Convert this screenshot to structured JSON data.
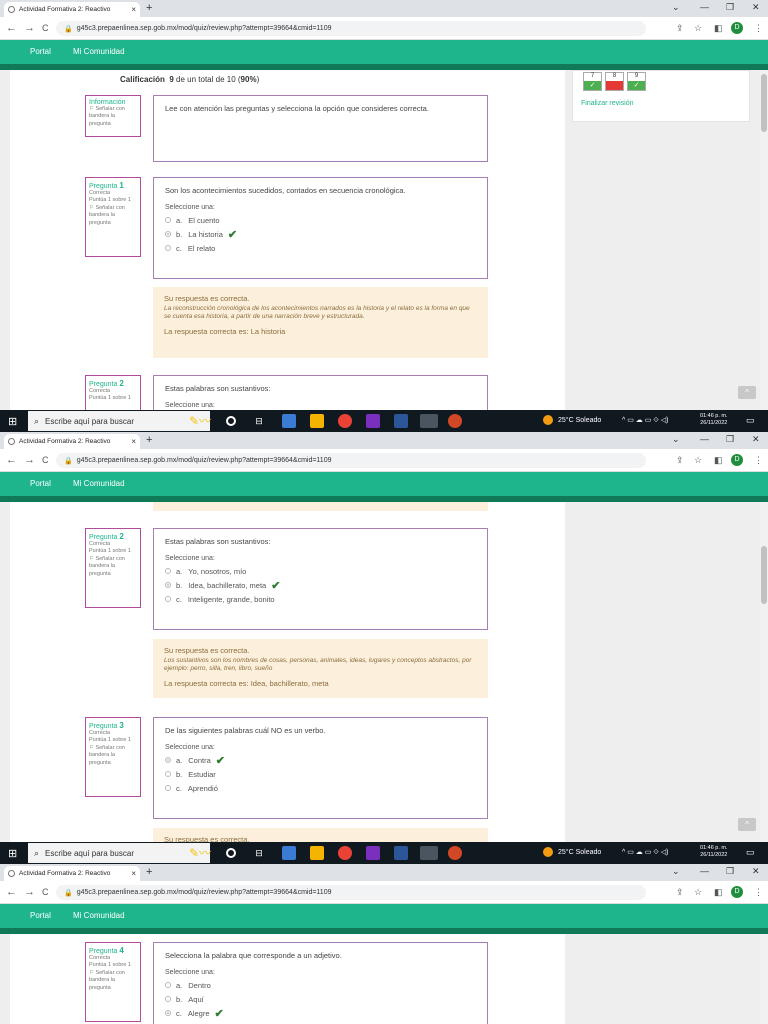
{
  "browser": {
    "tab_title": "Actividad Formativa 2: Reactivo",
    "tab_close": "×",
    "new_tab": "+",
    "url": "g45c3.prepaenlinea.sep.gob.mx/mod/quiz/review.php?attempt=39664&cmid=1109",
    "profile_initial": "D",
    "back": "←",
    "forward": "→",
    "reload": "C",
    "minimize": "—",
    "restore": "❐",
    "close": "✕",
    "dropdown": "⌄",
    "share_icon": "⇪",
    "star_icon": "☆",
    "sidebar_icon": "◧",
    "more_icon": "⋮"
  },
  "site_nav": {
    "portal": "Portal",
    "community": "Mi Comunidad"
  },
  "summary": {
    "label": "Calificación",
    "value_prefix": "9",
    "value_suffix": "de un total de 10 (",
    "percent": "90%",
    "close_paren": ")"
  },
  "info": {
    "title": "Información",
    "flag": "⚐ Señalar con bandera la pregunta",
    "text": "Lee con atención las preguntas y selecciona la opción que consideres correcta."
  },
  "nav_panel": {
    "buttons": [
      {
        "num": "7",
        "mark": "✓",
        "state": "good"
      },
      {
        "num": "8",
        "mark": "",
        "state": "bad"
      },
      {
        "num": "9",
        "mark": "✓",
        "state": "good"
      }
    ],
    "finish": "Finalizar revisión"
  },
  "common": {
    "question_word": "Pregunta",
    "state": "Correcta",
    "grade": "Puntúa 1 sobre 1",
    "flag": "⚐ Señalar con bandera la pregunta",
    "select_one": "Seleccione una:",
    "correct_msg": "Su respuesta es correcta.",
    "scroll_top": "^",
    "check": "✔"
  },
  "questions": [
    {
      "num": "1",
      "text": "Son los acontecimientos sucedidos, contados en secuencia cronológica.",
      "options": [
        {
          "letter": "a.",
          "text": "El cuento"
        },
        {
          "letter": "b.",
          "text": "La historia"
        },
        {
          "letter": "c.",
          "text": "El relato"
        }
      ],
      "explanation": "La reconstrucción cronológica de los acontecimientos narrados es la historia y el relato es la forma en que se cuenta esa historia, a partir de una narración breve y estructurada.",
      "answer": "La respuesta correcta es: La historia"
    },
    {
      "num": "2",
      "text": "Estas palabras son sustantivos:",
      "options": [
        {
          "letter": "a.",
          "text": "Yo, nosotros, mío"
        },
        {
          "letter": "b.",
          "text": "Idea, bachillerato, meta"
        },
        {
          "letter": "c.",
          "text": "Inteligente, grande, bonito"
        }
      ],
      "explanation": "Los sustantivos son los  nombres de cosas, personas, animales, ideas, lugares y conceptos abstractos, por ejemplo: perro, silla, tren, libro, sueño",
      "answer": "La respuesta correcta es: Idea, bachillerato, meta"
    },
    {
      "num": "3",
      "text": "De las siguientes palabras cuál NO es un verbo.",
      "options": [
        {
          "letter": "a.",
          "text": "Contra"
        },
        {
          "letter": "b.",
          "text": "Estudiar"
        },
        {
          "letter": "c.",
          "text": "Aprendió"
        }
      ]
    },
    {
      "num": "4",
      "text": "Selecciona la palabra que corresponde a un adjetivo.",
      "options": [
        {
          "letter": "a.",
          "text": "Dentro"
        },
        {
          "letter": "b.",
          "text": "Aquí"
        },
        {
          "letter": "c.",
          "text": "Alegre"
        }
      ]
    }
  ],
  "q2_peek": {
    "select_one": "Seleccione una:"
  },
  "taskbar": {
    "start_icon": "⊞",
    "search_placeholder": "Escribe aquí para buscar",
    "weather": "25°C  Soleado",
    "tray": "^  ▭  ☁  ▭  ⟐  ◁)",
    "time": "01:46 p. m.",
    "date": "26/11/2022",
    "notification": "▭"
  },
  "colors": {
    "accent": "#1eb58c",
    "accent_dark": "#107a58",
    "feedback_bg": "#fcefdc",
    "check": "#2e7d32",
    "bad": "#e53935",
    "good": "#4caf50"
  }
}
